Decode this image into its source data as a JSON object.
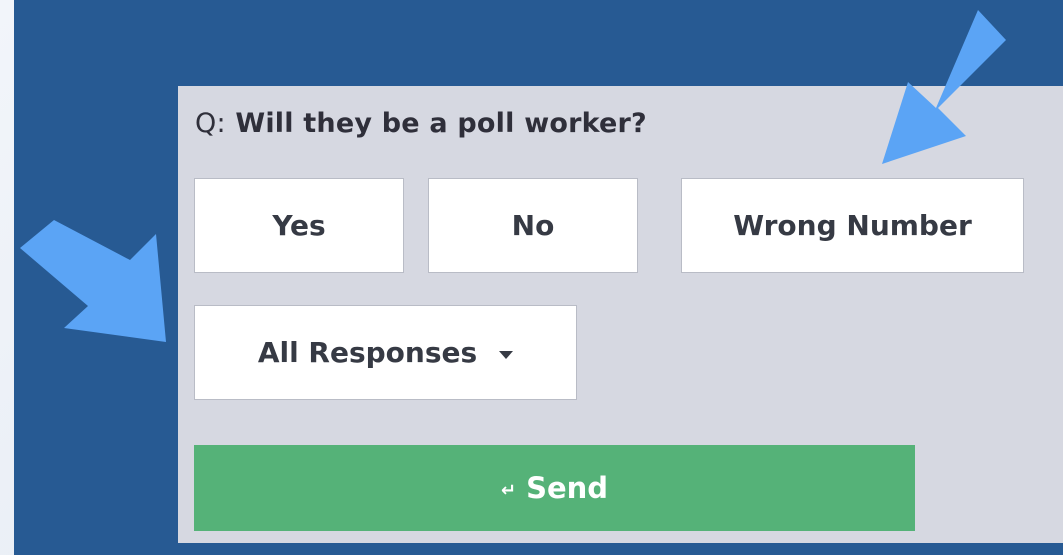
{
  "question": {
    "prefix": "Q:",
    "text": "Will they be a poll worker?"
  },
  "options": [
    {
      "label": "Yes"
    },
    {
      "label": "No"
    },
    {
      "label": "Wrong Number"
    }
  ],
  "dropdown": {
    "label": "All Responses",
    "icon": "chevron-down-icon"
  },
  "send": {
    "icon": "enter-icon",
    "icon_glyph": "↵",
    "label": "Send"
  },
  "annotations": {
    "arrow_count": 2,
    "arrow_color": "#5ba4f5"
  },
  "colors": {
    "background": "#275a93",
    "panel": "#d6d8e1",
    "send": "#55b278"
  }
}
